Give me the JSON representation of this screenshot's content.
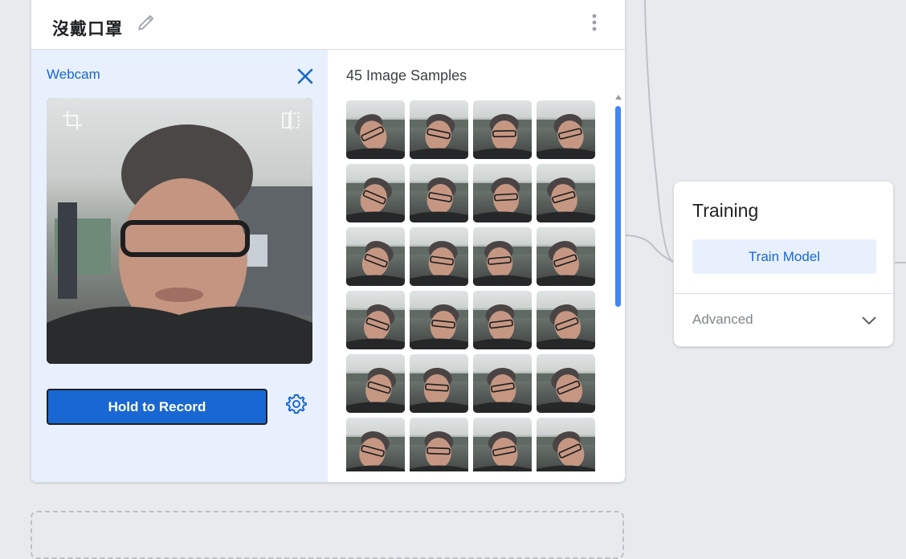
{
  "class_card": {
    "title": "沒戴口罩",
    "webcam_label": "Webcam",
    "record_button": "Hold to Record",
    "samples_title": "45 Image Samples",
    "visible_sample_count": 24
  },
  "training": {
    "title": "Training",
    "train_button": "Train Model",
    "advanced_label": "Advanced"
  },
  "colors": {
    "accent": "#1967d2",
    "panel_bg": "#e8f0fe",
    "canvas_bg": "#e8eaed"
  }
}
